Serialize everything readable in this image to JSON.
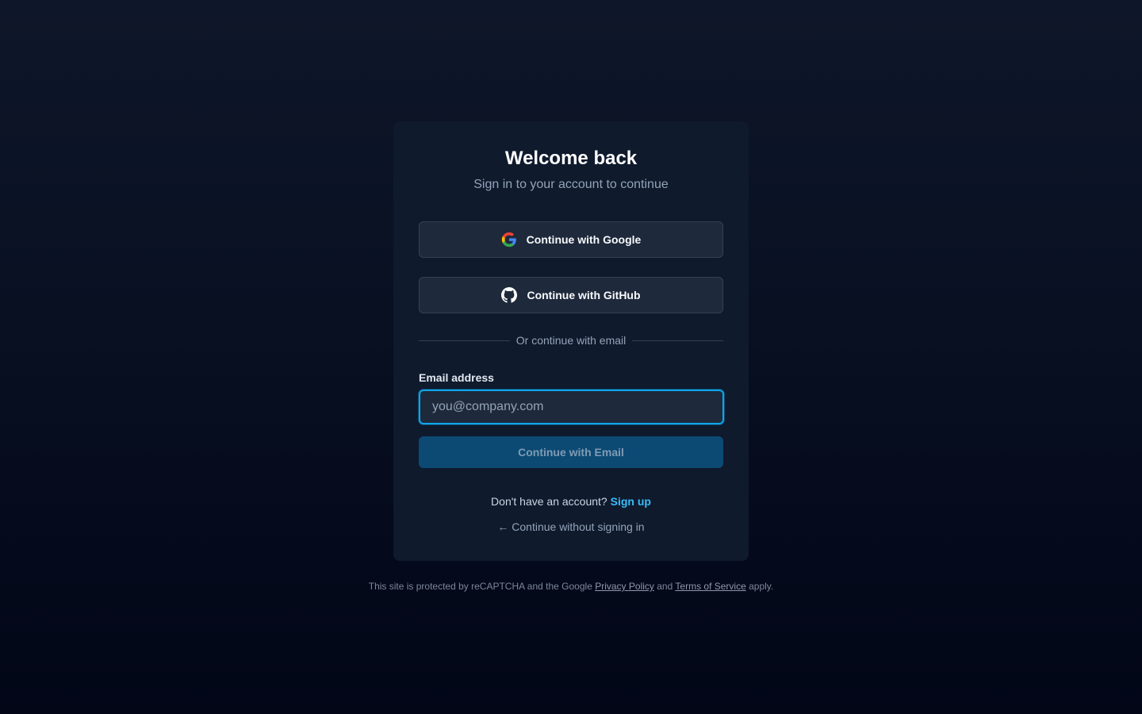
{
  "card": {
    "title": "Welcome back",
    "subtitle": "Sign in to your account to continue"
  },
  "oauth": {
    "google_label": "Continue with Google",
    "github_label": "Continue with GitHub",
    "google_icon": "google-icon",
    "github_icon": "github-icon"
  },
  "divider": {
    "text": "Or continue with email"
  },
  "email_form": {
    "label": "Email address",
    "value": "",
    "placeholder": "you@company.com",
    "submit_label": "Continue with Email"
  },
  "signup": {
    "prompt": "Don't have an account?",
    "link": "Sign up"
  },
  "guest": {
    "arrow": "←",
    "label": "Continue without signing in"
  },
  "footer": {
    "prefix": "This site is protected by reCAPTCHA and the Google",
    "privacy": "Privacy Policy",
    "and": "and",
    "terms": "Terms of Service",
    "suffix": "apply."
  },
  "colors": {
    "accent": "#0ea5e9",
    "link": "#38bdf8",
    "card_bg": "#0f1a2d",
    "button_bg": "#1e293b",
    "submit_bg": "#0c4a74"
  }
}
